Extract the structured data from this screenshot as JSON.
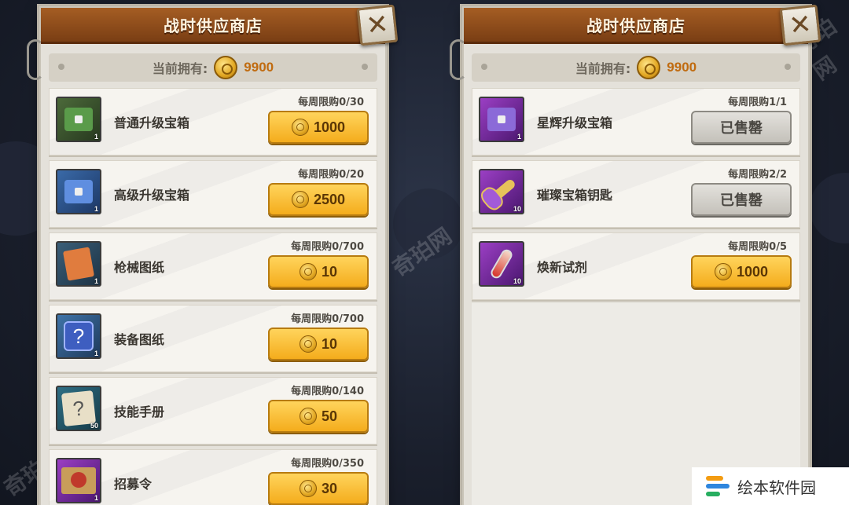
{
  "watermark": "奇珀网",
  "shop": {
    "title": "战时供应商店",
    "currency_label": "当前拥有:",
    "currency_amount": "9900"
  },
  "left_items": [
    {
      "name": "普通升级宝箱",
      "limit": "每周限购0/30",
      "price": "1000",
      "qty": "1",
      "icon": "green-chest-icon",
      "sold": false
    },
    {
      "name": "高级升级宝箱",
      "limit": "每周限购0/20",
      "price": "2500",
      "qty": "1",
      "icon": "blue-chest-icon",
      "sold": false
    },
    {
      "name": "枪械图纸",
      "limit": "每周限购0/700",
      "price": "10",
      "qty": "1",
      "icon": "weapon-blueprint-icon",
      "sold": false
    },
    {
      "name": "装备图纸",
      "limit": "每周限购0/700",
      "price": "10",
      "qty": "1",
      "icon": "question-badge-icon",
      "sold": false
    },
    {
      "name": "技能手册",
      "limit": "每周限购0/140",
      "price": "50",
      "qty": "50",
      "icon": "question-paper-icon",
      "sold": false
    },
    {
      "name": "招募令",
      "limit": "每周限购0/350",
      "price": "30",
      "qty": "1",
      "icon": "recruit-order-icon",
      "sold": false
    }
  ],
  "right_items": [
    {
      "name": "星辉升级宝箱",
      "limit": "每周限购1/1",
      "price": "已售罄",
      "qty": "1",
      "icon": "purple-chest-icon",
      "sold": true
    },
    {
      "name": "璀璨宝箱钥匙",
      "limit": "每周限购2/2",
      "price": "已售罄",
      "qty": "10",
      "icon": "key-icon",
      "sold": true
    },
    {
      "name": "焕新试剂",
      "limit": "每周限购0/5",
      "price": "1000",
      "qty": "10",
      "icon": "vial-icon",
      "sold": false
    }
  ],
  "brand": {
    "name": "绘本软件园"
  }
}
